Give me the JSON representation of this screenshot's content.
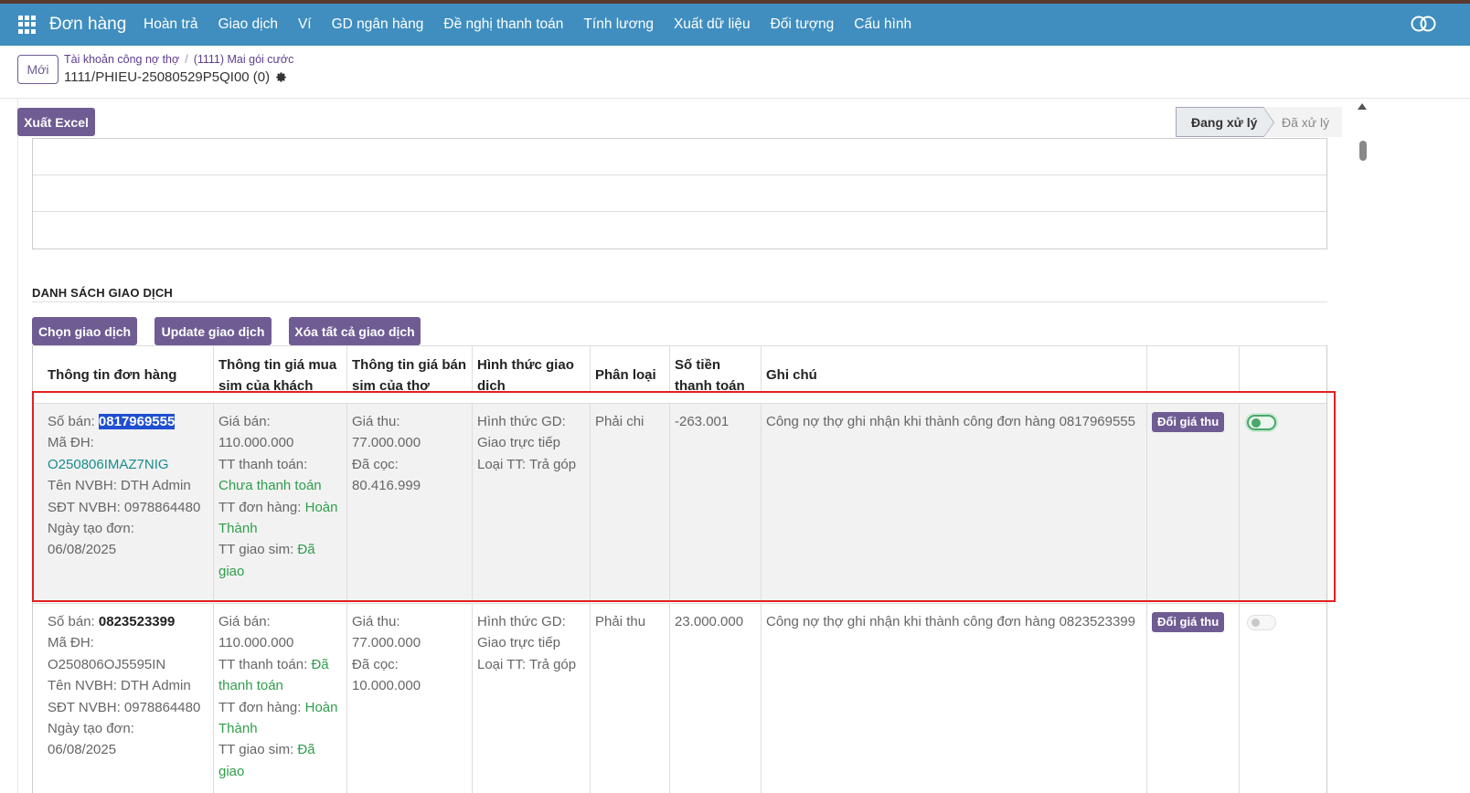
{
  "navbar": {
    "brand": "Đơn hàng",
    "menu": [
      "Hoàn trả",
      "Giao dịch",
      "Ví",
      "GD ngân hàng",
      "Đề nghị thanh toán",
      "Tính lương",
      "Xuất dữ liệu",
      "Đối tượng",
      "Cấu hình"
    ],
    "accent": "#3f8ebf"
  },
  "control": {
    "new_label": "Mới",
    "breadcrumb": [
      "Tài khoản công nợ thợ",
      "(1111) Mai gói cước"
    ],
    "breadcrumb_sep": "/",
    "record_title": "1111/PHIEU-25080529P5QI00 (0)"
  },
  "toolbar": {
    "export_label": "Xuất Excel",
    "status_active": "Đang xử lý",
    "status_next": "Đã xử lý"
  },
  "section": {
    "title": "DANH SÁCH GIAO DỊCH",
    "buttons": [
      "Chọn giao dịch",
      "Update giao dịch",
      "Xóa tất cả giao dịch"
    ]
  },
  "table": {
    "headers": [
      "Thông tin đơn hàng",
      "Thông tin giá mua sim của khách",
      "Thông tin giá bán sim của thợ",
      "Hình thức giao dịch",
      "Phân loại",
      "Số tiền thanh toán",
      "Ghi chú",
      "",
      ""
    ],
    "rows": [
      {
        "so_ban_label": "Số bán: ",
        "so_ban": "0817969555",
        "ma_dh_label": "Mã ĐH:",
        "ma_dh": "O250806IMAZ7NIG",
        "nvbh": "Tên NVBH: DTH Admin",
        "sdt": "SĐT NVBH: 0978864480",
        "ngay_label": "Ngày tạo đơn:",
        "ngay": "06/08/2025",
        "gia_ban_label": "Giá bán:",
        "gia_ban": "110.000.000",
        "tt_tt_label": "TT thanh toán:",
        "tt_tt": "Chưa thanh toán",
        "tt_dh_label": "TT đơn hàng: ",
        "tt_dh": "Hoàn Thành",
        "tt_gs_label": "TT giao sim: ",
        "tt_gs": "Đã giao",
        "gia_thu_label": "Giá thu:",
        "gia_thu": "77.000.000",
        "da_coc_label": "Đã cọc:",
        "da_coc": "80.416.999",
        "htgd_label": "Hình thức GD:",
        "htgd": "Giao trực tiếp",
        "loai_tt": "Loại TT: Trả góp",
        "phan_loai": "Phải chi",
        "so_tien": "-263.001",
        "ghi_chu": "Công nợ thợ ghi nhận khi thành công đơn hàng 0817969555",
        "action": "Đổi giá thu",
        "toggle": true
      },
      {
        "so_ban_label": "Số bán: ",
        "so_ban": "0823523399",
        "ma_dh_label": "Mã ĐH:",
        "ma_dh": "O250806OJ5595IN",
        "nvbh": "Tên NVBH: DTH Admin",
        "sdt": "SĐT NVBH: 0978864480",
        "ngay_label": "Ngày tạo đơn:",
        "ngay": "06/08/2025",
        "gia_ban_label": "Giá bán:",
        "gia_ban": "110.000.000",
        "tt_tt_label": "TT thanh toán: ",
        "tt_tt": "Đã thanh toán",
        "tt_dh_label": "TT đơn hàng: ",
        "tt_dh": "Hoàn Thành",
        "tt_gs_label": "TT giao sim: ",
        "tt_gs": "Đã giao",
        "gia_thu_label": "Giá thu:",
        "gia_thu": "77.000.000",
        "da_coc_label": "Đã cọc:",
        "da_coc": "10.000.000",
        "htgd_label": "Hình thức GD:",
        "htgd": "Giao trực tiếp",
        "loai_tt": "Loại TT: Trả góp",
        "phan_loai": "Phải thu",
        "so_tien": "23.000.000",
        "ghi_chu": "Công nợ thợ ghi nhận khi thành công đơn hàng 0823523399",
        "action": "Đổi giá thu",
        "toggle": false
      }
    ]
  },
  "colors": {
    "purple": "#6f5c93",
    "green": "#2e9e4c",
    "highlight": "#e02020"
  }
}
